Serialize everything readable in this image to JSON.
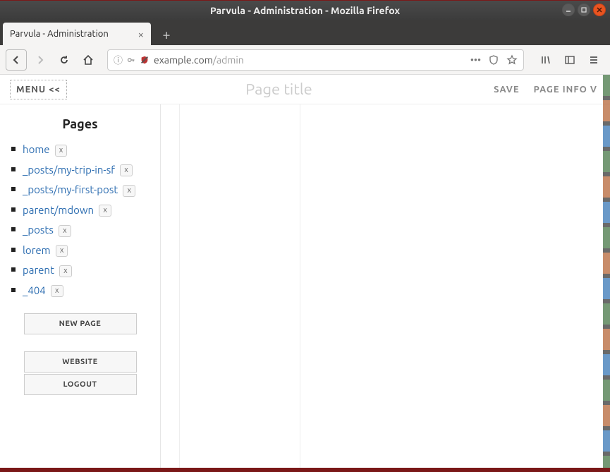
{
  "window": {
    "title": "Parvula - Administration - Mozilla Firefox"
  },
  "tab": {
    "title": "Parvula - Administration"
  },
  "url": {
    "host": "example.com",
    "path": "/admin"
  },
  "app_header": {
    "menu_label": "MENU <<",
    "title_placeholder": "Page title",
    "save_label": "SAVE",
    "page_info_label": "PAGE INFO V"
  },
  "sidebar": {
    "heading": "Pages",
    "delete_label": "x",
    "pages": [
      {
        "name": "home"
      },
      {
        "name": "_posts/my-trip-in-sf"
      },
      {
        "name": "_posts/my-first-post"
      },
      {
        "name": "parent/mdown"
      },
      {
        "name": "_posts"
      },
      {
        "name": "lorem"
      },
      {
        "name": "parent"
      },
      {
        "name": "_404"
      }
    ],
    "new_page_label": "NEW PAGE",
    "website_label": "WEBSITE",
    "logout_label": "LOGOUT"
  }
}
